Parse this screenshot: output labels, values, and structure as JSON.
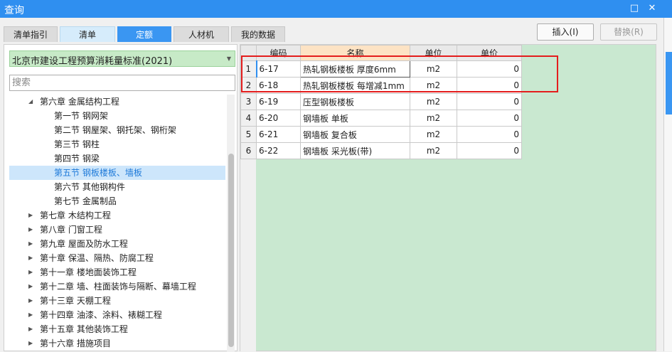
{
  "window": {
    "title": "查询",
    "restore_glyph": "□",
    "close_glyph": "✕"
  },
  "tabs": [
    {
      "label": "清单指引",
      "state": "inactive"
    },
    {
      "label": "清单",
      "state": "light"
    },
    {
      "label": "定额",
      "state": "active"
    },
    {
      "label": "人材机",
      "state": "inactive"
    },
    {
      "label": "我的数据",
      "state": "inactive"
    }
  ],
  "toolbar": {
    "insert_label": "插入(I)",
    "replace_label": "替换(R)"
  },
  "left": {
    "norm_select": {
      "value": "北京市建设工程预算消耗量标准(2021)"
    },
    "search": {
      "placeholder": "搜索"
    },
    "tree": [
      {
        "label": "第六章 金属结构工程",
        "level": 0,
        "expanded": true
      },
      {
        "label": "第一节 钢网架",
        "level": 1
      },
      {
        "label": "第二节 钢屋架、钢托架、钢桁架",
        "level": 1
      },
      {
        "label": "第三节 钢柱",
        "level": 1
      },
      {
        "label": "第四节 钢梁",
        "level": 1
      },
      {
        "label": "第五节 钢板楼板、墙板",
        "level": 1,
        "selected": true
      },
      {
        "label": "第六节 其他钢构件",
        "level": 1
      },
      {
        "label": "第七节 金属制品",
        "level": 1
      },
      {
        "label": "第七章 木结构工程",
        "level": 0,
        "expanded": false
      },
      {
        "label": "第八章 门窗工程",
        "level": 0,
        "expanded": false
      },
      {
        "label": "第九章 屋面及防水工程",
        "level": 0,
        "expanded": false
      },
      {
        "label": "第十章 保温、隔热、防腐工程",
        "level": 0,
        "expanded": false
      },
      {
        "label": "第十一章 楼地面装饰工程",
        "level": 0,
        "expanded": false
      },
      {
        "label": "第十二章 墙、柱面装饰与隔断、幕墙工程",
        "level": 0,
        "expanded": false
      },
      {
        "label": "第十三章 天棚工程",
        "level": 0,
        "expanded": false
      },
      {
        "label": "第十四章 油漆、涂料、裱糊工程",
        "level": 0,
        "expanded": false
      },
      {
        "label": "第十五章 其他装饰工程",
        "level": 0,
        "expanded": false
      },
      {
        "label": "第十六章 措施项目",
        "level": 0,
        "expanded": false
      }
    ]
  },
  "grid": {
    "columns": [
      "编码",
      "名称",
      "单位",
      "单价"
    ],
    "rows": [
      {
        "no": "1",
        "code": "6-17",
        "name": "热轧钢板楼板 厚度6mm",
        "unit": "m2",
        "price": "0"
      },
      {
        "no": "2",
        "code": "6-18",
        "name": "热轧钢板楼板 每增减1mm",
        "unit": "m2",
        "price": "0"
      },
      {
        "no": "3",
        "code": "6-19",
        "name": "压型钢板楼板",
        "unit": "m2",
        "price": "0"
      },
      {
        "no": "4",
        "code": "6-20",
        "name": "钢墙板 单板",
        "unit": "m2",
        "price": "0"
      },
      {
        "no": "5",
        "code": "6-21",
        "name": "钢墙板 复合板",
        "unit": "m2",
        "price": "0"
      },
      {
        "no": "6",
        "code": "6-22",
        "name": "钢墙板 采光板(带)",
        "unit": "m2",
        "price": "0"
      }
    ]
  },
  "colors": {
    "titlebar": "#2f8ff0",
    "active_tab": "#3a96f2",
    "selection": "#cde6fb",
    "grid_background": "#c9e8d0",
    "highlight_box": "#e41d1d"
  }
}
